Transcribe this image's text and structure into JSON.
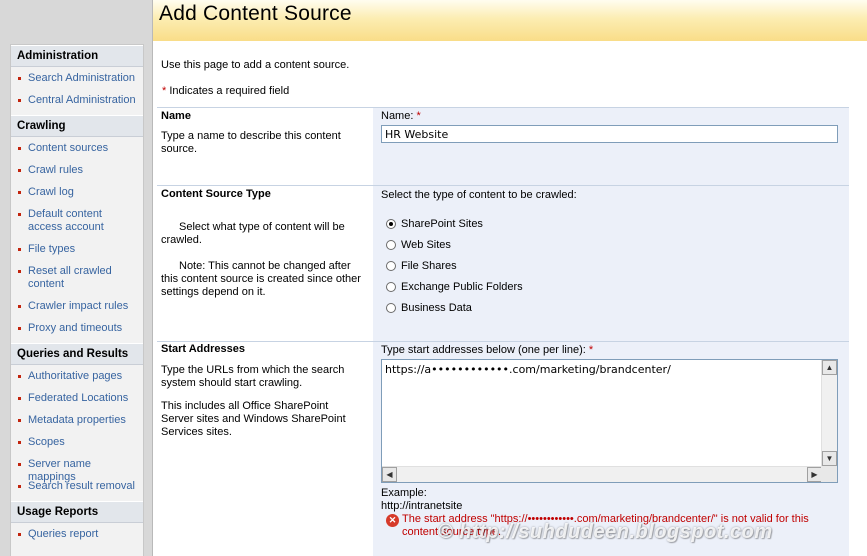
{
  "page": {
    "title": "Add Content Source"
  },
  "nav": {
    "groups": [
      {
        "title": "Administration",
        "items": [
          "Search Administration",
          "Central Administration"
        ]
      },
      {
        "title": "Crawling",
        "items": [
          "Content sources",
          "Crawl rules",
          "Crawl log",
          "Default content access account",
          "File types",
          "Reset all crawled content",
          "Crawler impact rules",
          "Proxy and timeouts"
        ]
      },
      {
        "title": "Queries and Results",
        "items": [
          "Authoritative pages",
          "Federated Locations",
          "Metadata properties",
          "Scopes",
          "Server name mappings",
          "Search result removal"
        ]
      },
      {
        "title": "Usage Reports",
        "items": [
          "Queries report"
        ]
      }
    ]
  },
  "intro": {
    "text": "Use this page to add a content source.",
    "required_star": "*",
    "required_note": "Indicates a required field"
  },
  "name_section": {
    "title": "Name",
    "description": "Type a name to describe this content source.",
    "field_label": "Name:",
    "star": "*",
    "value": "HR Website"
  },
  "type_section": {
    "title": "Content Source Type",
    "description": "Select what type of content will be crawled.",
    "note": "Note: This cannot be changed after this content source is created since other settings depend on it.",
    "prompt": "Select the type of content to be crawled:",
    "options": [
      "SharePoint Sites",
      "Web Sites",
      "File Shares",
      "Exchange Public Folders",
      "Business Data"
    ],
    "selected": "SharePoint Sites"
  },
  "address_section": {
    "title": "Start Addresses",
    "description1": "Type the URLs from which the search system should start crawling.",
    "description2": "This includes all Office SharePoint Server sites and Windows SharePoint Services sites.",
    "field_label": "Type start addresses below (one per line):",
    "star": "*",
    "value": "https://a••••••••••••.com/marketing/brandcenter/",
    "example_label": "Example:",
    "example_value": "http://intranetsite",
    "error": "The start address \"https://••••••••••••.com/marketing/brandcenter/\" is not valid for this content source type."
  },
  "watermark": "© http://suhdudeen.blogspot.com",
  "colors": {
    "nav_link": "#3764a0",
    "required": "#c00000",
    "panel": "#ecf0f9",
    "title_bar": "#f9dd88"
  }
}
